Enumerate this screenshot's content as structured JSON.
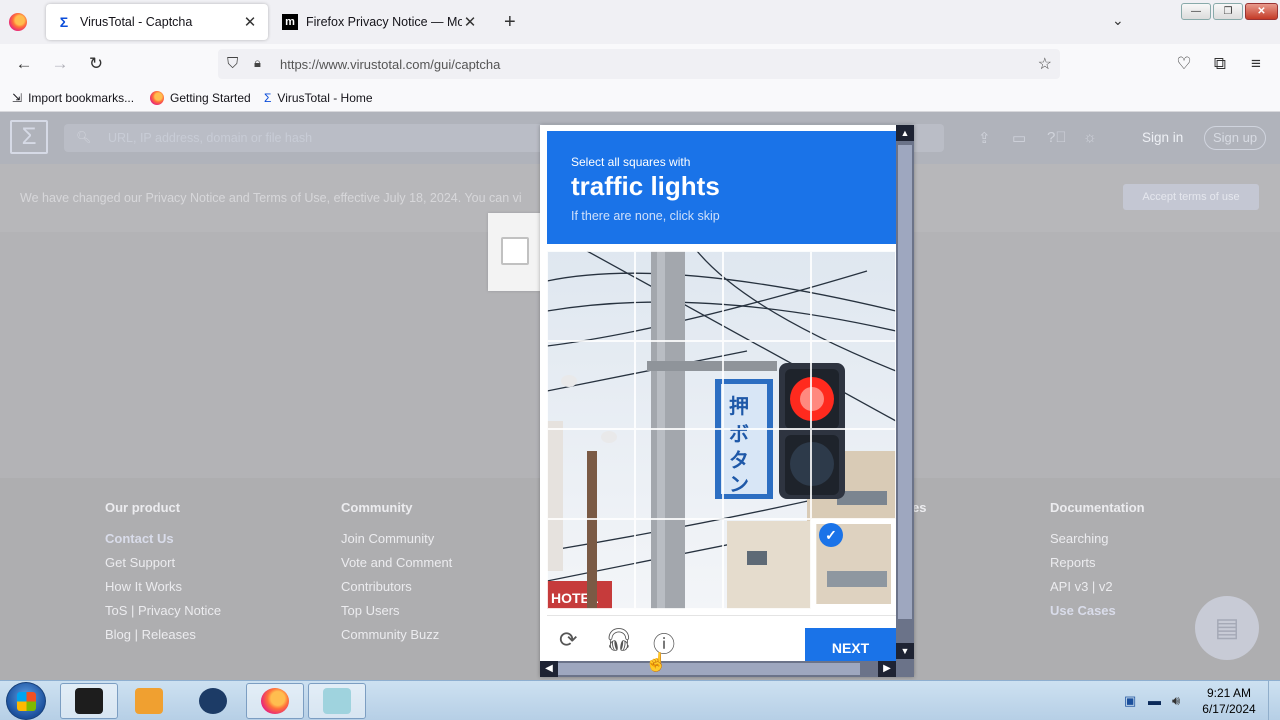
{
  "browser": {
    "tabs": [
      {
        "title": "VirusTotal - Captcha",
        "active": true
      },
      {
        "title": "Firefox Privacy Notice — Mozill",
        "active": false
      }
    ],
    "new_tab": "+",
    "list_tabs": "⌄",
    "window": {
      "minimize": "—",
      "maximize": "❐",
      "close": "✕"
    },
    "url": "https://www.virustotal.com/gui/captcha",
    "bookmarks": [
      "Import bookmarks...",
      "Getting Started",
      "VirusTotal - Home"
    ]
  },
  "page": {
    "search_placeholder": "URL, IP address, domain or file hash",
    "sign_in": "Sign in",
    "sign_up": "Sign up",
    "notice_text": "We have changed our Privacy Notice and Terms of Use, effective July 18, 2024. You can vi",
    "accept_label": "Accept terms of use",
    "footer": {
      "our_product": {
        "title": "Our product",
        "links": [
          "Contact Us",
          "Get Support",
          "How It Works",
          "ToS | Privacy Notice",
          "Blog | Releases"
        ]
      },
      "community": {
        "title": "Community",
        "links": [
          "Join Community",
          "Vote and Comment",
          "Contributors",
          "Top Users",
          "Community Buzz"
        ]
      },
      "third": {
        "title": "es"
      },
      "documentation": {
        "title": "Documentation",
        "links": [
          "Searching",
          "Reports",
          "API v3 | v2",
          "Use Cases"
        ]
      }
    }
  },
  "captcha": {
    "instruction": "Select all squares with",
    "target": "traffic lights",
    "hint": "If there are none, click skip",
    "next_label": "NEXT",
    "selected_tiles": [
      15
    ]
  },
  "taskbar": {
    "time": "9:21 AM",
    "date": "6/17/2024"
  },
  "colors": {
    "captcha_blue": "#1a73e8",
    "overlay": "#b3b3b6"
  }
}
